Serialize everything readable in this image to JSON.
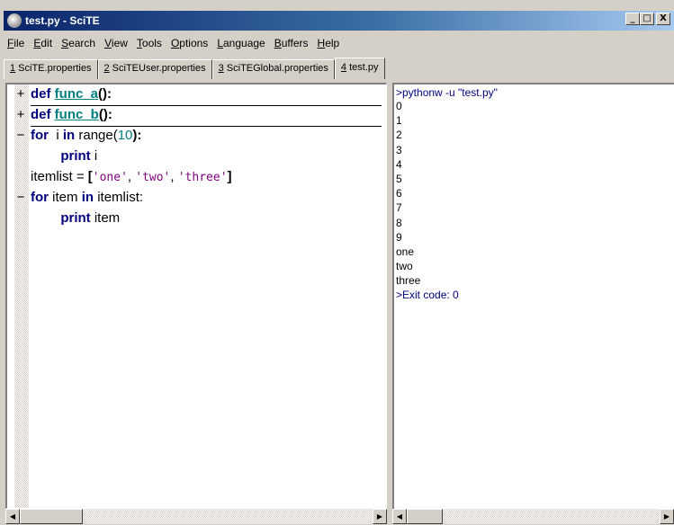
{
  "window": {
    "title": "test.py - SciTE",
    "controls": {
      "minimize": "_",
      "maximize": "□",
      "close": "X"
    }
  },
  "menu": [
    {
      "key": "F",
      "rest": "ile"
    },
    {
      "key": "E",
      "rest": "dit"
    },
    {
      "key": "S",
      "rest": "earch"
    },
    {
      "key": "V",
      "rest": "iew"
    },
    {
      "key": "T",
      "rest": "ools"
    },
    {
      "key": "O",
      "rest": "ptions"
    },
    {
      "key": "L",
      "rest": "anguage"
    },
    {
      "key": "B",
      "rest": "uffers"
    },
    {
      "key": "H",
      "rest": "elp"
    }
  ],
  "tabs": [
    {
      "num": "1",
      "name": " SciTE.properties"
    },
    {
      "num": "2",
      "name": " SciTEUser.properties"
    },
    {
      "num": "3",
      "name": " SciTEGlobal.properties"
    },
    {
      "num": "4",
      "name": " test.py",
      "active": true
    }
  ],
  "editor": {
    "lines": [
      {
        "fold": "+",
        "parts": [
          [
            "kw",
            "def "
          ],
          [
            "fn",
            "func_a"
          ],
          [
            "op",
            "():"
          ]
        ],
        "folded": true
      },
      {
        "fold": "+",
        "parts": [
          [
            "kw",
            "def "
          ],
          [
            "fn",
            "func_b"
          ],
          [
            "op",
            "():"
          ]
        ],
        "folded": true
      },
      {
        "fold": "−",
        "parts": [
          [
            "kw",
            "for"
          ],
          [
            "",
            "  i "
          ],
          [
            "kw",
            "in"
          ],
          [
            "",
            " range("
          ],
          [
            "num",
            "10"
          ],
          [
            "op",
            "):"
          ]
        ]
      },
      {
        "fold": "",
        "parts": [
          [
            "",
            "        "
          ],
          [
            "kw",
            "print"
          ],
          [
            "",
            " i"
          ]
        ]
      },
      {
        "fold": "",
        "parts": [
          [
            "",
            "itemlist = "
          ],
          [
            "op",
            "["
          ],
          [
            "str",
            "'one'"
          ],
          [
            "",
            ", "
          ],
          [
            "str",
            "'two'"
          ],
          [
            "",
            ", "
          ],
          [
            "str",
            "'three'"
          ],
          [
            "op",
            "]"
          ]
        ]
      },
      {
        "fold": "−",
        "parts": [
          [
            "kw",
            "for"
          ],
          [
            "",
            " item "
          ],
          [
            "kw",
            "in"
          ],
          [
            "",
            " itemlist:"
          ]
        ]
      },
      {
        "fold": "",
        "parts": [
          [
            "",
            "        "
          ],
          [
            "kw",
            "print"
          ],
          [
            "",
            " item"
          ]
        ]
      }
    ]
  },
  "output": {
    "command": ">pythonw -u \"test.py\"",
    "lines": [
      "0",
      "1",
      "2",
      "3",
      "4",
      "5",
      "6",
      "7",
      "8",
      "9",
      "one",
      "two",
      "three"
    ],
    "exit": ">Exit code: 0"
  },
  "scrollbars": {
    "left_arrow": "◀",
    "right_arrow": "▶"
  }
}
